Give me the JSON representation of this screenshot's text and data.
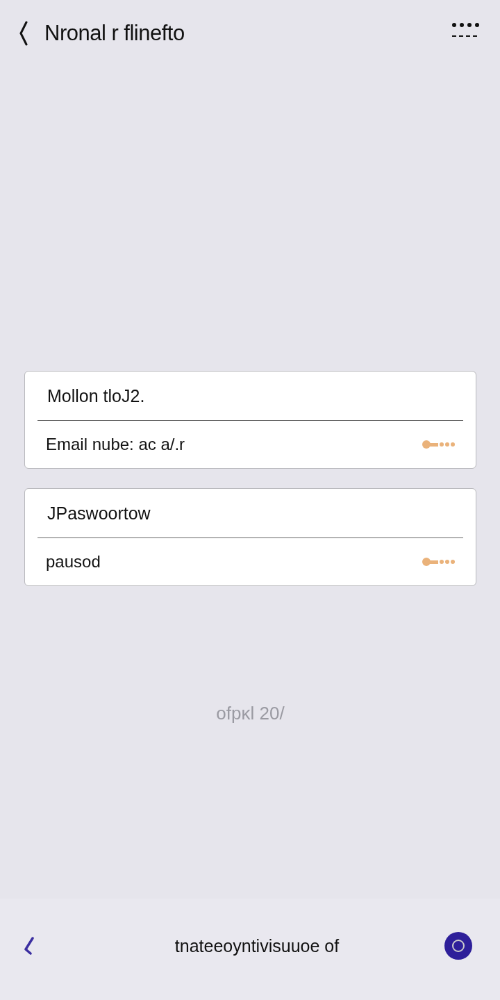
{
  "header": {
    "title": "Nronal r flinefto"
  },
  "cards": [
    {
      "label": "Mollon tloJ2.",
      "field": "Email nube: ac  a/.r"
    },
    {
      "label": "JPaswoortow",
      "field": "pausod"
    }
  ],
  "center_text": "ofpκl 20/",
  "bottom_bar": {
    "text": "tnateeoyntivisuuoe of"
  }
}
